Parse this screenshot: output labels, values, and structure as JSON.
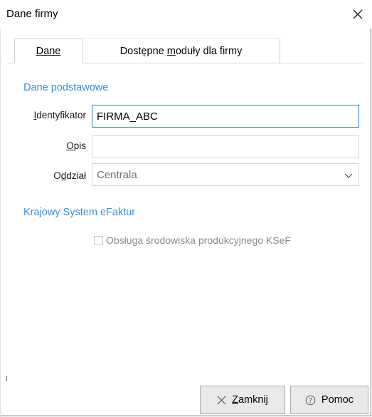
{
  "window": {
    "title": "Dane firmy",
    "close_icon": "close-icon"
  },
  "tabs": [
    {
      "label": "Dane",
      "active": true
    },
    {
      "label_pre": "Dostępne ",
      "label_ul": "m",
      "label_post": "oduły dla firmy",
      "active": false
    }
  ],
  "basic": {
    "header": "Dane podstawowe",
    "identifier": {
      "label_ul": "I",
      "label_rest": "dentyfikator",
      "value": "FIRMA_ABC"
    },
    "description": {
      "label_ul": "O",
      "label_rest": "pis",
      "value": ""
    },
    "branch": {
      "label_pre": "O",
      "label_ul": "d",
      "label_rest": "dział",
      "value": "Centrala"
    }
  },
  "ksef": {
    "header": "Krajowy System eFaktur",
    "checkbox_label": "Obsługa środowiska produkcyjnego KSeF",
    "checked": false,
    "enabled": false
  },
  "footer": {
    "close_ul": "Z",
    "close_rest": "amknij",
    "help_label": "Pomoc"
  },
  "colors": {
    "accent": "#3b8fd6",
    "focus_border": "#2a7fd4",
    "disabled_text": "#8a8a8a"
  }
}
